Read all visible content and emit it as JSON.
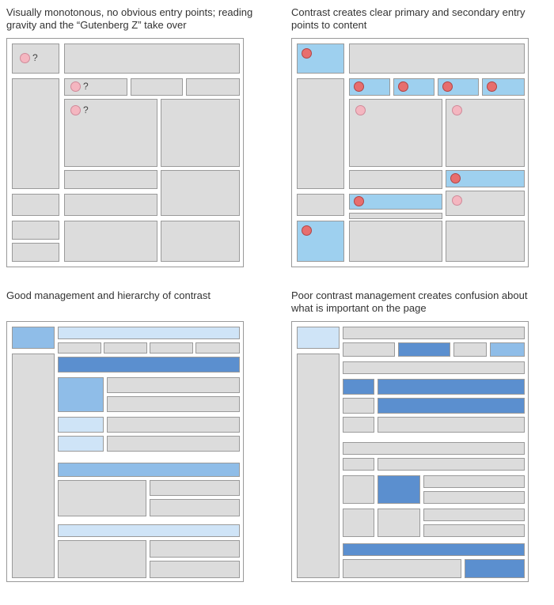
{
  "panels": {
    "tl": {
      "caption": "Visually monotonous, no obvious entry points; reading gravity and the “Gutenberg Z” take over"
    },
    "tr": {
      "caption": "Contrast creates clear primary and secondary entry points to content"
    },
    "bl": {
      "caption": "Good management and hierarchy of contrast"
    },
    "br": {
      "caption": "Poor contrast management creates confusion about what is important on the page"
    }
  },
  "q": "?",
  "colors": {
    "gray": "#dcdcdc",
    "lightblue": "#cfe4f7",
    "medblue": "#8fbde8",
    "darkblue": "#5b8fcf",
    "skyblue": "#9ed0ef",
    "dotred": "#e76e6e",
    "dotpink": "#f4b6c0"
  }
}
